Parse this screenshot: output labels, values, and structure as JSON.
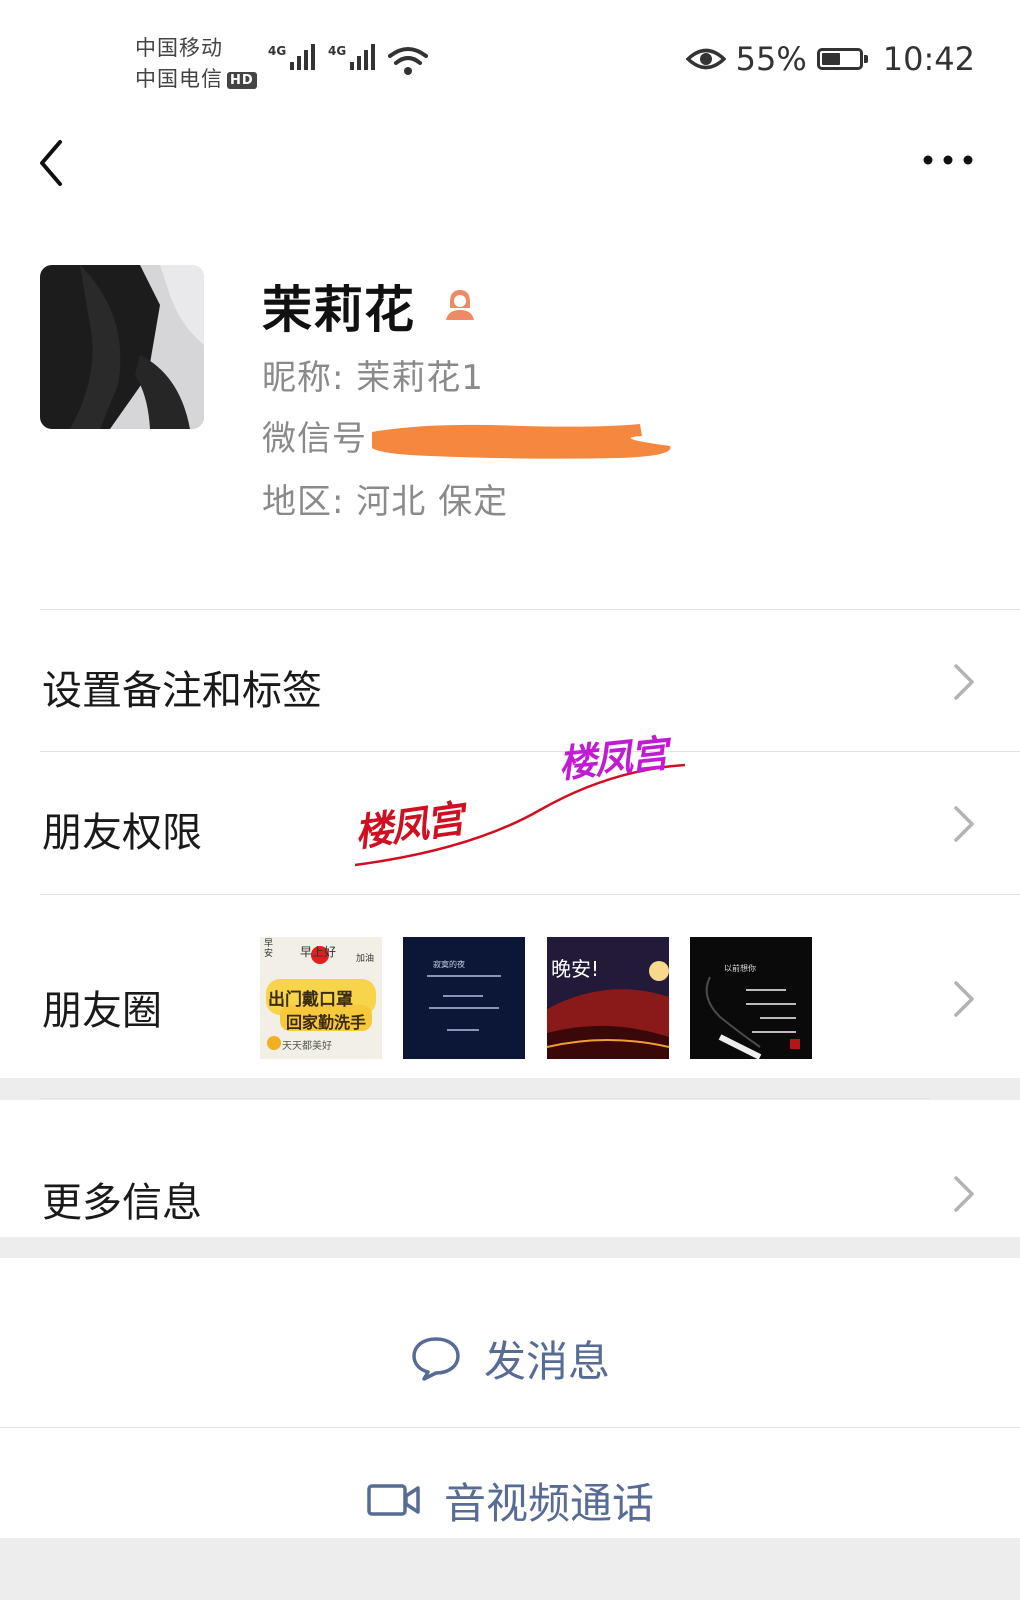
{
  "status_bar": {
    "carrier1": "中国移动",
    "carrier2": "中国电信",
    "hd": "HD",
    "net1": "4G",
    "net2": "4G",
    "battery": "55%",
    "battery_level": 0.55,
    "time": "10:42"
  },
  "nav": {
    "back_icon": "chevron-left",
    "more_icon": "more-dots"
  },
  "profile": {
    "name": "茉莉花",
    "nickname": "昵称: 茉莉花1",
    "wechat_id": "微信号",
    "region": "地区: 河北  保定"
  },
  "rows": {
    "remark": "设置备注和标签",
    "permissions": "朋友权限",
    "moments": "朋友圈",
    "more_info": "更多信息"
  },
  "moments_thumbs": [
    {
      "text1": "早上好",
      "text2": "出门戴口罩",
      "text3": "回家勤洗手",
      "text4": "天天都美好",
      "text5": "早安",
      "text6": "加油"
    },
    {
      "text1": "寂寞的夜"
    },
    {
      "text1": "晚安!"
    },
    {
      "text1": "以前想你"
    }
  ],
  "watermark": {
    "text1": "楼凤宫",
    "text2": "楼凤宫"
  },
  "actions": {
    "message": "发消息",
    "call": "音视频通话"
  },
  "colors": {
    "link": "#576b95",
    "background": "#ededed",
    "redact": "#f5873f",
    "gender_icon": "#ef8a66"
  }
}
